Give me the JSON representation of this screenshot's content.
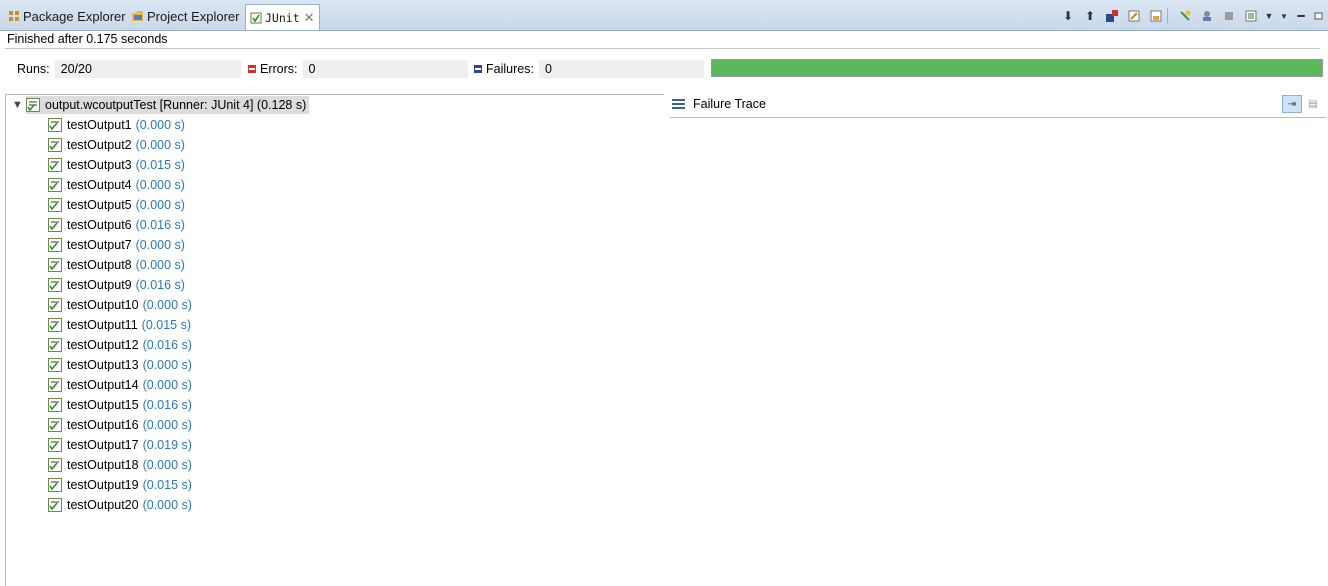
{
  "tabs": [
    {
      "label": "Package Explorer",
      "icon": "package-explorer-icon"
    },
    {
      "label": "Project Explorer",
      "icon": "project-explorer-icon"
    },
    {
      "label": "JUnit",
      "icon": "junit-icon",
      "active": true
    }
  ],
  "toolbar": {
    "items": [
      "next-failure-icon",
      "previous-failure-icon",
      "failures-only-icon",
      "scroll-lock-icon",
      "history-icon",
      "rerun-test-icon",
      "rerun-failed-first-icon",
      "stop-icon",
      "test-run-history-icon",
      "view-menu-icon",
      "minimize-icon",
      "maximize-icon"
    ]
  },
  "status": "Finished after 0.175 seconds",
  "counters": {
    "runs_label": "Runs:",
    "runs_value": "20/20",
    "errors_label": "Errors:",
    "errors_value": "0",
    "failures_label": "Failures:",
    "failures_value": "0"
  },
  "progress": {
    "fraction": 1.0,
    "color": "#5ab85a"
  },
  "tree": {
    "root": "output.wcoutputTest [Runner: JUnit 4] (0.128 s)",
    "tests": [
      {
        "name": "testOutput1",
        "time": "(0.000 s)"
      },
      {
        "name": "testOutput2",
        "time": "(0.000 s)"
      },
      {
        "name": "testOutput3",
        "time": "(0.015 s)"
      },
      {
        "name": "testOutput4",
        "time": "(0.000 s)"
      },
      {
        "name": "testOutput5",
        "time": "(0.000 s)"
      },
      {
        "name": "testOutput6",
        "time": "(0.016 s)"
      },
      {
        "name": "testOutput7",
        "time": "(0.000 s)"
      },
      {
        "name": "testOutput8",
        "time": "(0.000 s)"
      },
      {
        "name": "testOutput9",
        "time": "(0.016 s)"
      },
      {
        "name": "testOutput10",
        "time": "(0.000 s)"
      },
      {
        "name": "testOutput11",
        "time": "(0.015 s)"
      },
      {
        "name": "testOutput12",
        "time": "(0.016 s)"
      },
      {
        "name": "testOutput13",
        "time": "(0.000 s)"
      },
      {
        "name": "testOutput14",
        "time": "(0.000 s)"
      },
      {
        "name": "testOutput15",
        "time": "(0.016 s)"
      },
      {
        "name": "testOutput16",
        "time": "(0.000 s)"
      },
      {
        "name": "testOutput17",
        "time": "(0.019 s)"
      },
      {
        "name": "testOutput18",
        "time": "(0.000 s)"
      },
      {
        "name": "testOutput19",
        "time": "(0.015 s)"
      },
      {
        "name": "testOutput20",
        "time": "(0.000 s)"
      }
    ]
  },
  "failure_trace": {
    "title": "Failure Trace"
  }
}
